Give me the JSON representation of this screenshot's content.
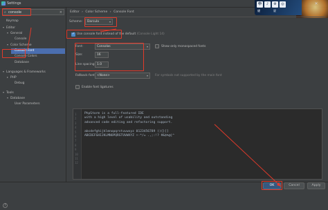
{
  "window": {
    "title": "Settings",
    "close_glyph": "✕"
  },
  "overlay": {
    "chips": [
      "中",
      "♪",
      "⚙",
      "◎"
    ],
    "caption_left": "键",
    "caption_right": "说"
  },
  "search": {
    "value": "console",
    "icon": "search-icon",
    "clear_glyph": "×"
  },
  "tree": [
    {
      "label": "Keymap",
      "arrow": "",
      "indent": 0,
      "selected": false
    },
    {
      "label": "Editor",
      "arrow": "▾",
      "indent": 0,
      "selected": false
    },
    {
      "label": "General",
      "arrow": "▾",
      "indent": 1,
      "selected": false
    },
    {
      "label": "Console",
      "arrow": "",
      "indent": 2,
      "selected": false
    },
    {
      "label": "Color Scheme",
      "arrow": "▾",
      "indent": 1,
      "selected": false
    },
    {
      "label": "Console Font",
      "arrow": "",
      "indent": 2,
      "selected": true
    },
    {
      "label": "Console Colors",
      "arrow": "",
      "indent": 2,
      "selected": false
    },
    {
      "label": "Database",
      "arrow": "",
      "indent": 2,
      "selected": false
    },
    {
      "label": "Languages & Frameworks",
      "arrow": "▾",
      "indent": 0,
      "selected": false
    },
    {
      "label": "PHP",
      "arrow": "▸",
      "indent": 1,
      "selected": false
    },
    {
      "label": "Debug",
      "arrow": "",
      "indent": 2,
      "selected": false
    },
    {
      "label": "Tools",
      "arrow": "▾",
      "indent": 0,
      "selected": false
    },
    {
      "label": "Database",
      "arrow": "▾",
      "indent": 1,
      "selected": false
    },
    {
      "label": "User Parameters",
      "arrow": "",
      "indent": 2,
      "selected": false
    }
  ],
  "breadcrumb": {
    "editor": "Editor",
    "sep": "›",
    "color_scheme": "Color Scheme",
    "page": "Console Font"
  },
  "scheme": {
    "label": "Scheme:",
    "value": "Darcula"
  },
  "use_console_font": {
    "checked": true,
    "label": "Use console font instead of the default",
    "hint": "(Console Light 14)"
  },
  "font": {
    "label": "Font:",
    "value": "Consolas"
  },
  "monospaced": {
    "checked": false,
    "label": "Show only monospaced fonts"
  },
  "size": {
    "label": "Size:",
    "value": "16"
  },
  "line_spacing": {
    "label": "Line spacing:",
    "value": "1.0"
  },
  "fallback": {
    "label": "Fallback font:",
    "value": "<None>",
    "hint": "For symbols not supported by the main font"
  },
  "ligatures": {
    "checked": false,
    "label": "Enable font ligatures"
  },
  "preview": {
    "lines": [
      "PhpStorm is a full-featured IDE",
      "with a high level of usability and outstanding",
      "advanced code editing and refactoring support.",
      "",
      "abcdefghijklmnopqrstuvwxyz 0123456789 (){}[]",
      "ABCDEFGHIJKLMNOPQRSTUVWXYZ +-*/= .,;:!? #&$%@|^",
      "",
      "",
      "",
      "",
      "",
      ""
    ]
  },
  "buttons": {
    "ok": "OK",
    "cancel": "Cancel",
    "apply": "Apply"
  },
  "help": {
    "glyph": "?"
  },
  "colors": {
    "accent": "#4b6eaf",
    "annotation": "#e33a2a",
    "background": "#3c3f41",
    "editor_bg": "#2b2b2b"
  }
}
